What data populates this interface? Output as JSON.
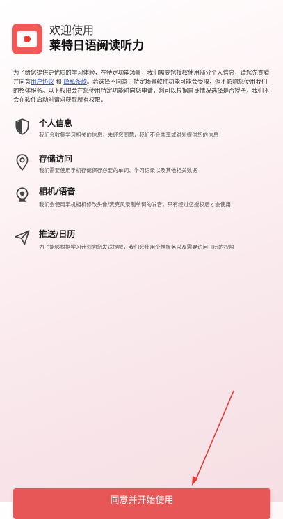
{
  "header": {
    "welcome": "欢迎使用",
    "app_name": "莱特日语阅读听力"
  },
  "intro": {
    "part1": "为了给您提供更优质的学习体验，在特定功能场景，我们需要您授权使用部分个人信息，请您先查看并同意",
    "user_agreement": "用户协议",
    "and": " 和 ",
    "privacy_policy": "隐私条款",
    "part2": "。若选择不同意，特定场景软件功能可能会受限，但不影响您使用我们的整体服务。以下权限会在您使用特定功能时向您申请，您可以根据自身情况选择是否授予，我们不会在软件启动时请求获取所有权限。"
  },
  "permissions": [
    {
      "icon": "shield-icon",
      "title": "个人信息",
      "desc": "我们会收集学习相关的信息，未经您同意，我们不会共享或对外提供您的信息"
    },
    {
      "icon": "location-pin-icon",
      "title": "存储访问",
      "desc": "我们需要使用手机存储保存必要的单词、学习记录以及其他相关数据"
    },
    {
      "icon": "camera-icon",
      "title": "相机/语音",
      "desc": "我们会使用手机相机修改头像/麦克风录制单词的发音，只有经过您授权后才会使用"
    },
    {
      "icon": "send-icon",
      "title": "推送/日历",
      "desc": "为了能够根据学习计划向您发送提醒，我们会使用个推服务以及需要访问日历的权限"
    }
  ],
  "agree_button": "同意并开始使用",
  "colors": {
    "accent": "#e85757",
    "link": "#2b55c9",
    "arrow": "#e53935"
  }
}
